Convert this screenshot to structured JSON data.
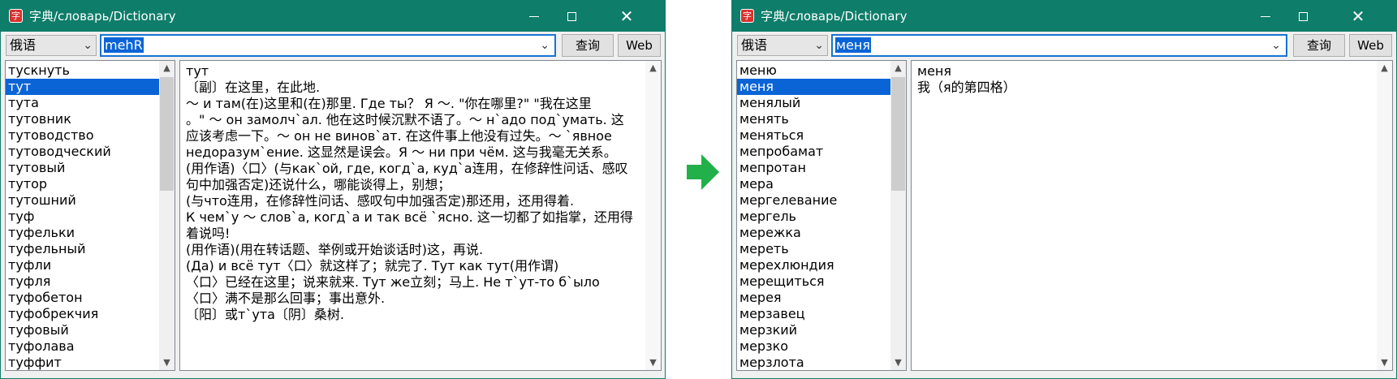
{
  "window_title": "字典/словарь/Dictionary",
  "colors": {
    "titlebar": "#0e7d6a",
    "selection": "#0a64d6",
    "arrow": "#22b04b"
  },
  "left": {
    "language": "俄语",
    "query": "mehR",
    "buttons": {
      "lookup": "查询",
      "web": "Web"
    },
    "words": [
      "тускнуть",
      "тут",
      "тута",
      "тутовник",
      "тутоводство",
      "тутоводческий",
      "тутовый",
      "тутор",
      "тутошний",
      "туф",
      "туфельки",
      "туфельный",
      "туфли",
      "туфля",
      "туфобетон",
      "туфобрекчия",
      "туфовый",
      "туфолава",
      "туффит"
    ],
    "selected_index": 1,
    "definition": [
      "тут",
      "〔副〕在这里，在此地.",
      "～ и там(在)这里和(在)那里.   Где ты？  Я ～. \"你在哪里?\" \"我在这里",
      "。\" ～ он замолч`ал. 他在这时候沉默不语了。～ н`адо под`умать. 这",
      "应该考虑一下。～ он не винов`ат. 在这件事上他没有过失。～ `явное",
      "недоразум`ение. 这显然是误会。Я ～ ни при чём. 这与我毫无关系。",
      "(用作语)〈口〉(与как`ой, где, когд`а, куд`а连用，在修辞性问话、感叹",
      "句中加强否定)还说什么，哪能谈得上，别想；",
      "(与что连用，在修辞性问话、感叹句中加强否定)那还用，还用得着.",
      "К чем`у ～ слов`а, когд`а и так всё `ясно. 这一切都了如指掌，还用得",
      "着说吗!",
      "(用作语)(用在转话题、举例或开始谈话时)这，再说.",
      "(Да) и всё тут〈口〉就这样了；就完了. Тут как тут(用作谓)",
      "〈口〉已经在这里；说来就来. Тут же立刻；马上. Не т`ут-то б`ыло",
      "〈口〉满不是那么回事；事出意外.",
      "〔阳〕或т`ута〔阴〕桑树."
    ]
  },
  "right": {
    "language": "俄语",
    "query": "меня",
    "buttons": {
      "lookup": "查询",
      "web": "Web"
    },
    "words": [
      "меню",
      "меня",
      "менялый",
      "менять",
      "меняться",
      "мепробамат",
      "мепротан",
      "мера",
      "мергелевание",
      "мергель",
      "мережка",
      "мереть",
      "мерехлюндия",
      "мерещиться",
      "мерея",
      "мерзавец",
      "мерзкий",
      "мерзко",
      "мерзлота"
    ],
    "selected_index": 1,
    "definition": [
      "меня",
      "我（я的第四格）"
    ]
  }
}
